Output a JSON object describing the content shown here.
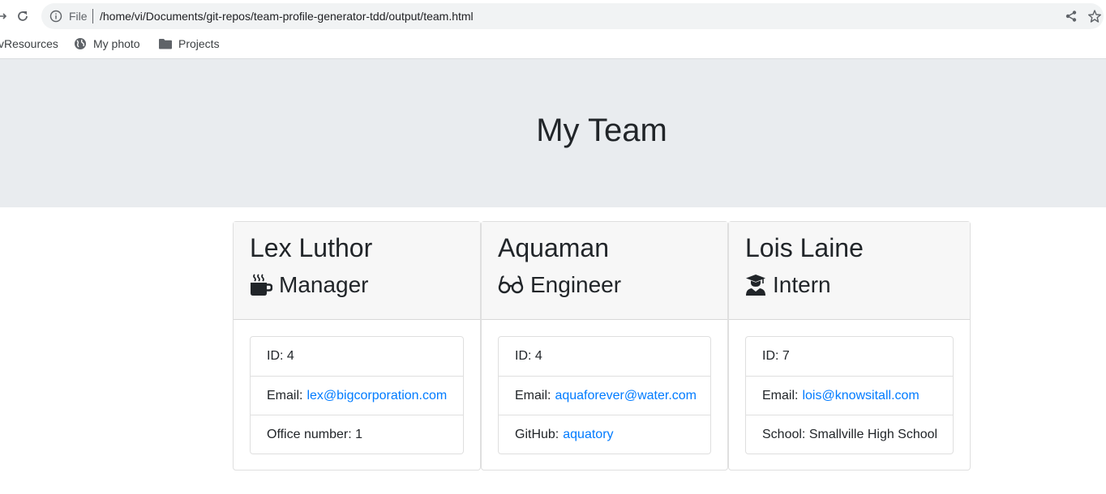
{
  "browser": {
    "scheme_label": "File",
    "url": "/home/vi/Documents/git-repos/team-profile-generator-tdd/output/team.html",
    "bookmarks": [
      {
        "label": "vResources",
        "icon": "none"
      },
      {
        "label": "My photo",
        "icon": "globe-icon"
      },
      {
        "label": "Projects",
        "icon": "folder-icon"
      }
    ]
  },
  "page": {
    "title": "My Team"
  },
  "team": [
    {
      "name": "Lex Luthor",
      "role": "Manager",
      "role_icon": "coffee-mug-icon",
      "id_label": "ID: 4",
      "email_label": "Email:",
      "email": "lex@bigcorporation.com",
      "extra_label": "Office number: 1",
      "extra_link": ""
    },
    {
      "name": "Aquaman",
      "role": "Engineer",
      "role_icon": "glasses-icon",
      "id_label": "ID: 4",
      "email_label": "Email:",
      "email": "aquaforever@water.com",
      "extra_label": "GitHub:",
      "extra_link": "aquatory"
    },
    {
      "name": "Lois Laine",
      "role": "Intern",
      "role_icon": "graduate-icon",
      "id_label": "ID: 7",
      "email_label": "Email:",
      "email": "lois@knowsitall.com",
      "extra_label": "School: Smallville High School",
      "extra_link": ""
    }
  ],
  "colors": {
    "link": "#007bff",
    "jumbotron_bg": "#e9ecef",
    "card_header_bg": "#f7f7f7"
  }
}
